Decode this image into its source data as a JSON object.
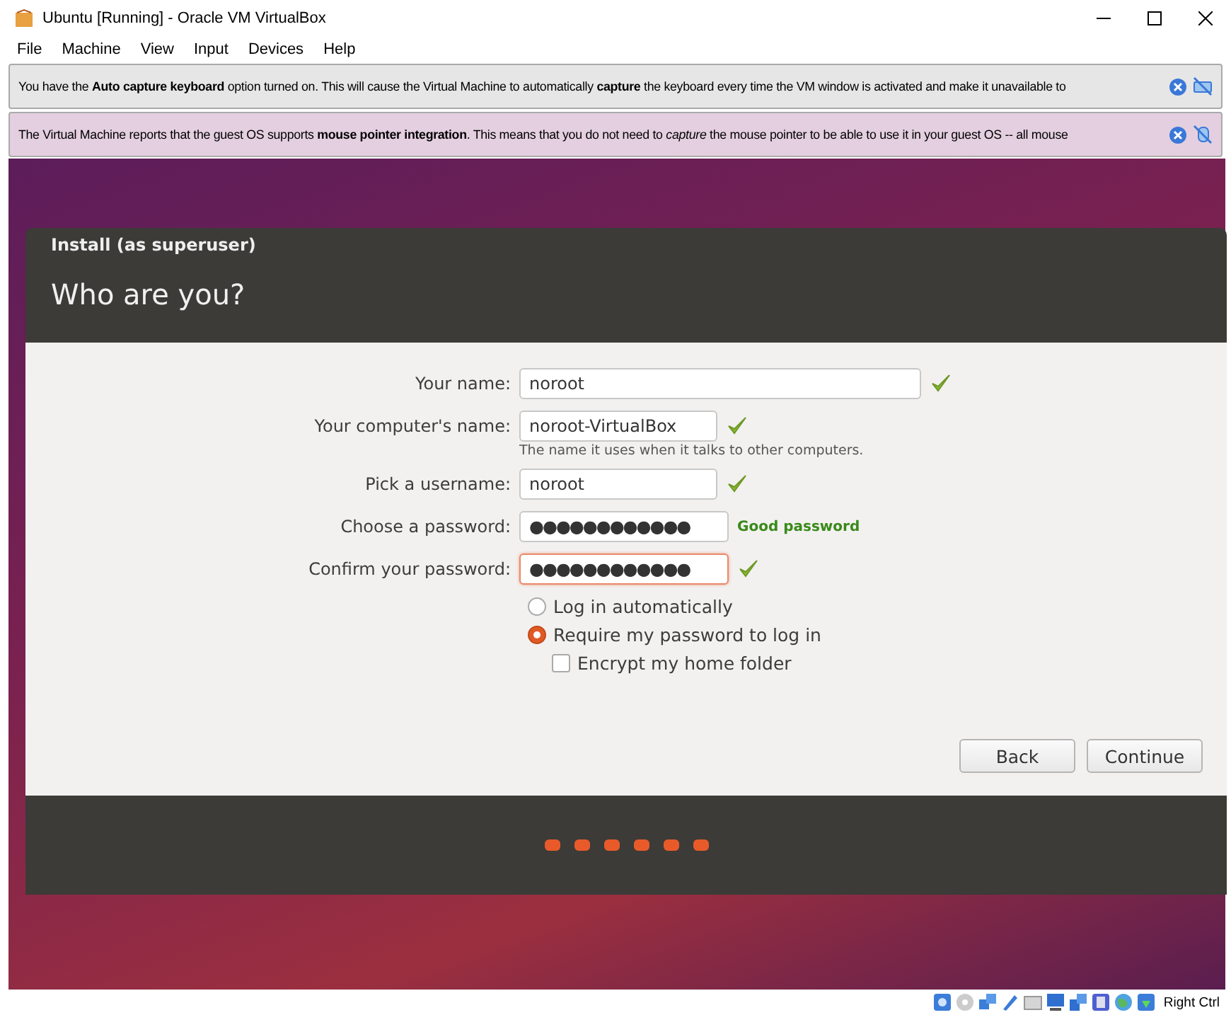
{
  "window": {
    "title": "Ubuntu [Running] - Oracle VM VirtualBox"
  },
  "menu": [
    "File",
    "Machine",
    "View",
    "Input",
    "Devices",
    "Help"
  ],
  "notices": [
    {
      "kind": "keyboard",
      "text": "You have the **Auto capture keyboard** option turned on. This will cause the Virtual Machine to automatically **capture** the keyboard every time the VM window is activated and make it unavailable to"
    },
    {
      "kind": "mouse",
      "text": "The Virtual Machine reports that the guest OS supports **mouse pointer integration**. This means that you do not need to *capture* the mouse pointer to be able to use it in your guest OS -- all mouse"
    }
  ],
  "installer": {
    "section": "Install (as superuser)",
    "heading": "Who are you?",
    "fields": [
      {
        "kind": "text",
        "label": "Your name:",
        "value": "noroot",
        "valid": true,
        "focused": false
      },
      {
        "kind": "text",
        "label": "Your computer's name:",
        "value": "noroot-VirtualBox",
        "valid": true,
        "focused": false,
        "hint": "The name it uses when it talks to other computers."
      },
      {
        "kind": "text",
        "label": "Pick a username:",
        "value": "noroot",
        "valid": true,
        "focused": false
      },
      {
        "kind": "password",
        "label": "Choose a password:",
        "value": "●●●●●●●●●●●●",
        "valid": false,
        "focused": false,
        "strength": "Good password"
      },
      {
        "kind": "password",
        "label": "Confirm your password:",
        "value": "●●●●●●●●●●●●",
        "valid": true,
        "focused": true
      }
    ],
    "options": [
      {
        "kind": "radio",
        "label": "Log in automatically",
        "selected": false
      },
      {
        "kind": "radio",
        "label": "Require my password to log in",
        "selected": true
      },
      {
        "kind": "checkbox",
        "label": "Encrypt my home folder",
        "checked": false
      }
    ],
    "buttons": [
      "Back",
      "Continue"
    ]
  },
  "status_bar": {
    "host_key": "Right Ctrl"
  }
}
